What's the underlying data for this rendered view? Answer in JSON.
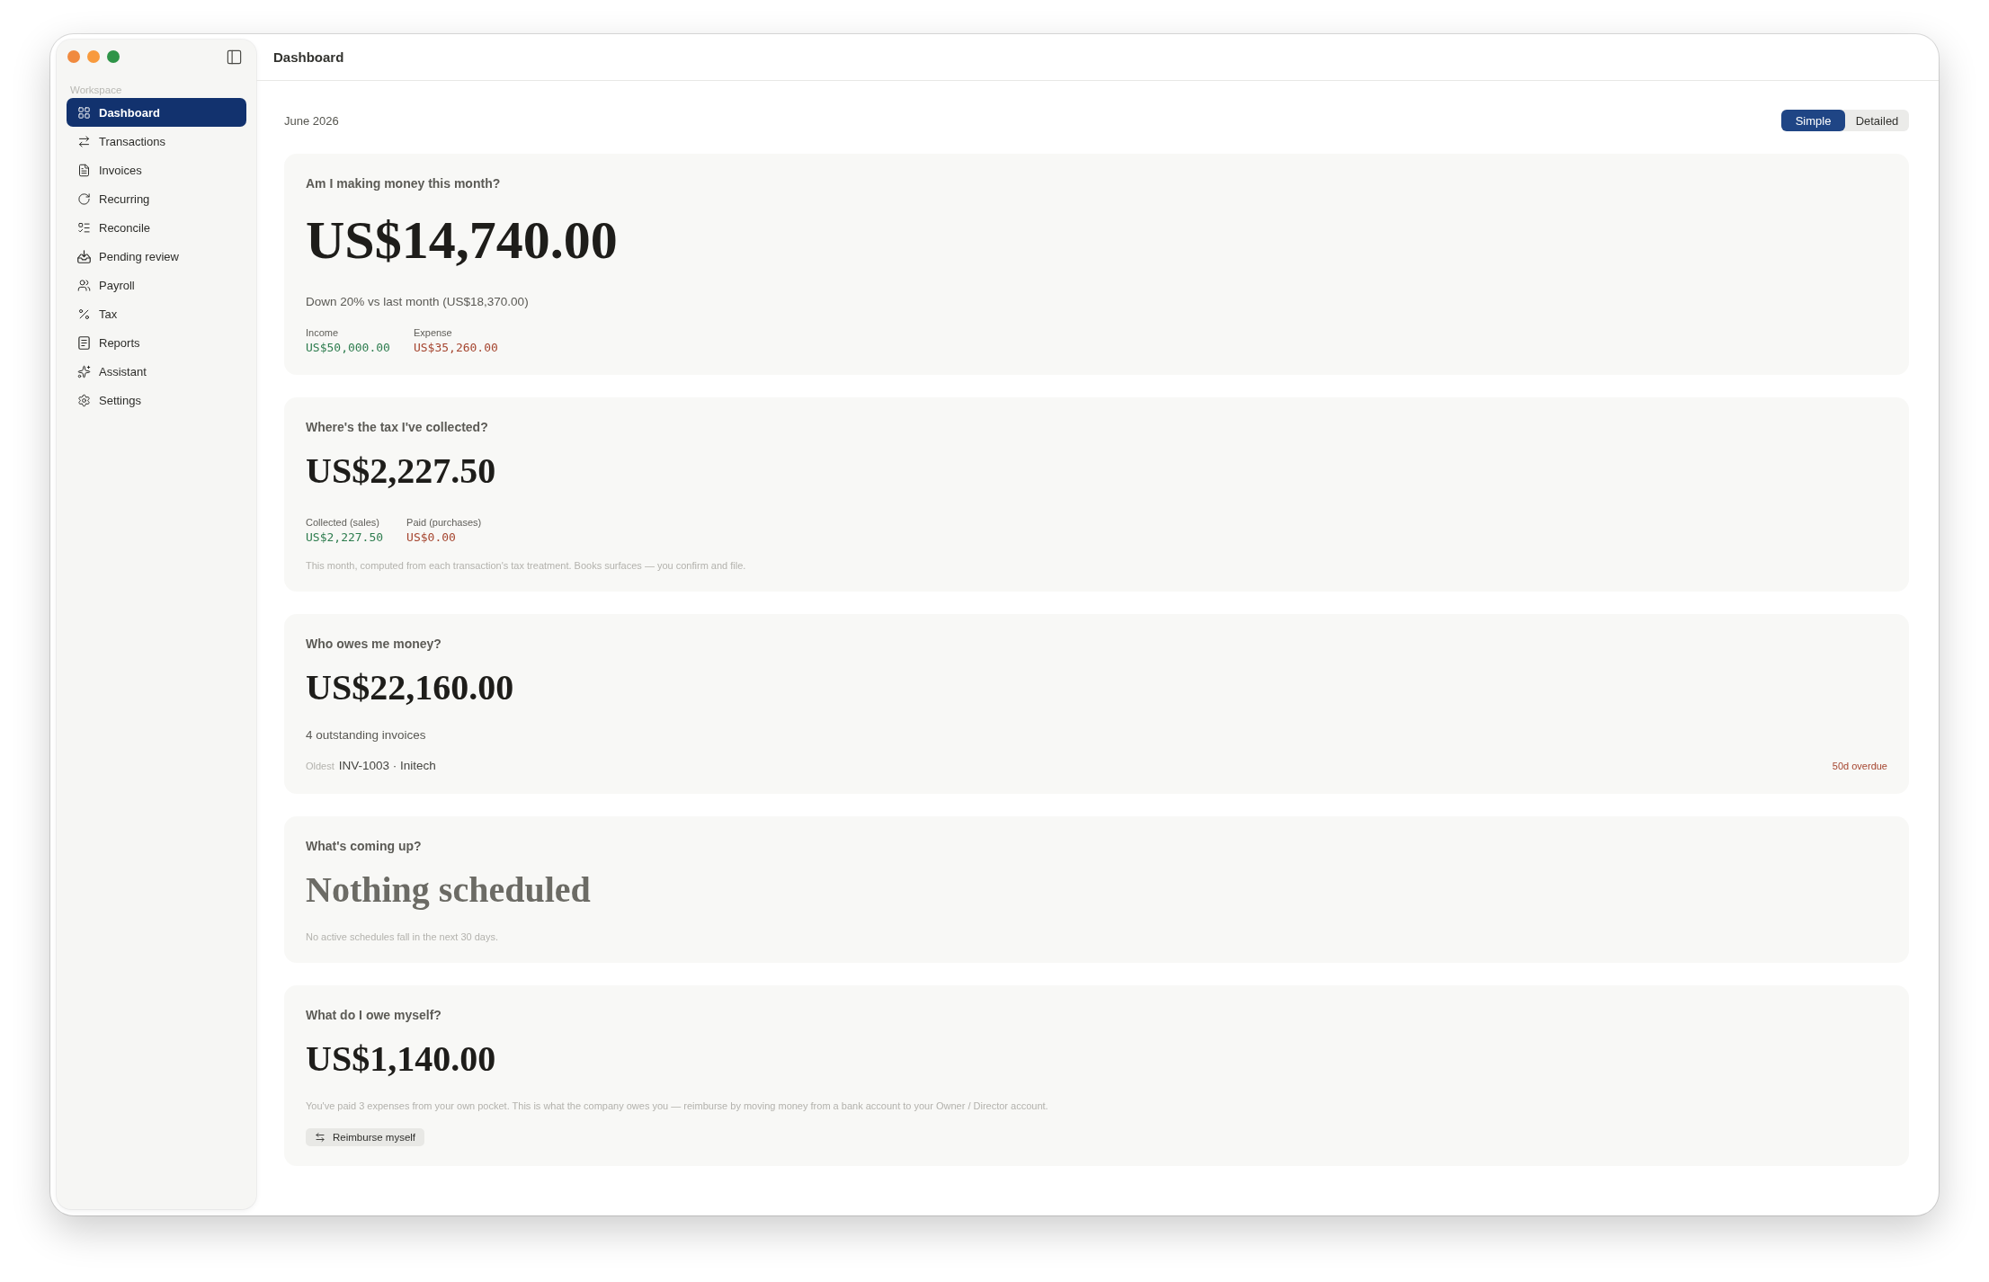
{
  "sidebar": {
    "section_label": "Workspace",
    "items": [
      {
        "label": "Dashboard",
        "selected": true
      },
      {
        "label": "Transactions",
        "selected": false
      },
      {
        "label": "Invoices",
        "selected": false
      },
      {
        "label": "Recurring",
        "selected": false
      },
      {
        "label": "Reconcile",
        "selected": false
      },
      {
        "label": "Pending review",
        "selected": false
      },
      {
        "label": "Payroll",
        "selected": false
      },
      {
        "label": "Tax",
        "selected": false
      },
      {
        "label": "Reports",
        "selected": false
      },
      {
        "label": "Assistant",
        "selected": false
      },
      {
        "label": "Settings",
        "selected": false
      }
    ]
  },
  "header": {
    "title": "Dashboard"
  },
  "period": "June 2026",
  "view_toggle": [
    {
      "label": "Simple",
      "selected": true
    },
    {
      "label": "Detailed",
      "selected": false
    }
  ],
  "cards": [
    {
      "kind": "headline",
      "question": "Am I making money this month?",
      "amount": "US$14,740.00",
      "note": "Down 20% vs last month (US$18,370.00)",
      "figures": [
        {
          "label": "Income",
          "value": "US$50,000.00",
          "color": "#2e7d4f"
        },
        {
          "label": "Expense",
          "value": "US$35,260.00",
          "color": "#a5452f"
        }
      ]
    },
    {
      "kind": "figure",
      "question": "Where's the tax I've collected?",
      "amount": "US$2,227.50",
      "figures": [
        {
          "label": "Collected (sales)",
          "value": "US$2,227.50",
          "color": "#2e7d4f"
        },
        {
          "label": "Paid (purchases)",
          "value": "US$0.00",
          "color": "#a5452f"
        }
      ],
      "footnote": "This month, computed from each transaction's tax treatment. Books surfaces — you confirm and file."
    },
    {
      "kind": "figure",
      "question": "Who owes me money?",
      "amount": "US$22,160.00",
      "note": "4 outstanding invoices",
      "oldest": {
        "label": "Oldest",
        "invoice": "INV-1003 · Initech",
        "status": "50d overdue"
      }
    },
    {
      "kind": "empty",
      "question": "What's coming up?",
      "amount": "Nothing scheduled",
      "footnote": "No active schedules fall in the next 30 days."
    },
    {
      "kind": "figure",
      "question": "What do I owe myself?",
      "amount": "US$1,140.00",
      "footnote": "You've paid 3 expenses from your own pocket. This is what the company owes you — reimburse by moving money from a bank account to your Owner / Director account.",
      "action": {
        "label": "Reimburse myself"
      }
    }
  ]
}
